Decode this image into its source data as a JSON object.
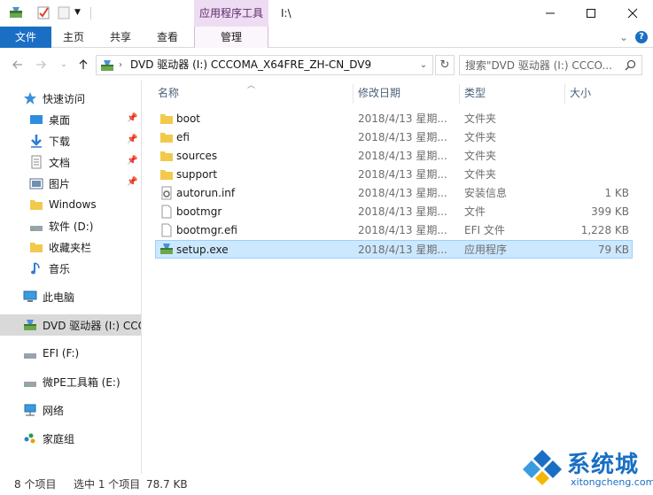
{
  "titlebar": {
    "context_tab": "应用程序工具",
    "path": "I:\\",
    "quick_access_icons": [
      "drive-setup-icon",
      "properties-icon",
      "new-folder-icon",
      "customize-dropdown-icon"
    ]
  },
  "ribbon": {
    "tabs": [
      {
        "label": "文件",
        "active": true
      },
      {
        "label": "主页"
      },
      {
        "label": "共享"
      },
      {
        "label": "查看"
      },
      {
        "label": "管理"
      }
    ]
  },
  "address_bar": {
    "path": "DVD 驱动器 (I:) CCCOMA_X64FRE_ZH-CN_DV9",
    "search_placeholder": "搜索\"DVD 驱动器 (I:) CCCO..."
  },
  "sidebar": {
    "items": [
      {
        "label": "快速访问",
        "icon": "star-icon"
      },
      {
        "label": "桌面",
        "icon": "desktop-icon",
        "pinned": true
      },
      {
        "label": "下载",
        "icon": "download-icon",
        "pinned": true
      },
      {
        "label": "文档",
        "icon": "document-icon",
        "pinned": true
      },
      {
        "label": "图片",
        "icon": "picture-icon",
        "pinned": true
      },
      {
        "label": "Windows",
        "icon": "folder-icon"
      },
      {
        "label": "软件 (D:)",
        "icon": "drive-icon"
      },
      {
        "label": "收藏夹栏",
        "icon": "folder-icon"
      },
      {
        "label": "音乐",
        "icon": "music-icon"
      },
      {
        "label": "此电脑",
        "icon": "computer-icon"
      },
      {
        "label": "DVD 驱动器 (I:) CCC",
        "icon": "dvd-drive-icon",
        "selected": true
      },
      {
        "label": "EFI (F:)",
        "icon": "drive-icon"
      },
      {
        "label": "微PE工具箱 (E:)",
        "icon": "drive-icon"
      },
      {
        "label": "网络",
        "icon": "network-icon"
      },
      {
        "label": "家庭组",
        "icon": "homegroup-icon"
      }
    ]
  },
  "columns": [
    "名称",
    "修改日期",
    "类型",
    "大小"
  ],
  "files": [
    {
      "name": "boot",
      "date": "2018/4/13 星期...",
      "type": "文件夹",
      "size": "",
      "icon": "folder-icon"
    },
    {
      "name": "efi",
      "date": "2018/4/13 星期...",
      "type": "文件夹",
      "size": "",
      "icon": "folder-icon"
    },
    {
      "name": "sources",
      "date": "2018/4/13 星期...",
      "type": "文件夹",
      "size": "",
      "icon": "folder-icon"
    },
    {
      "name": "support",
      "date": "2018/4/13 星期...",
      "type": "文件夹",
      "size": "",
      "icon": "folder-icon"
    },
    {
      "name": "autorun.inf",
      "date": "2018/4/13 星期...",
      "type": "安装信息",
      "size": "1 KB",
      "icon": "settings-file-icon"
    },
    {
      "name": "bootmgr",
      "date": "2018/4/13 星期...",
      "type": "文件",
      "size": "399 KB",
      "icon": "file-icon"
    },
    {
      "name": "bootmgr.efi",
      "date": "2018/4/13 星期...",
      "type": "EFI 文件",
      "size": "1,228 KB",
      "icon": "file-icon"
    },
    {
      "name": "setup.exe",
      "date": "2018/4/13 星期...",
      "type": "应用程序",
      "size": "79 KB",
      "icon": "setup-app-icon",
      "selected": true
    }
  ],
  "status": {
    "item_count": "8 个项目",
    "selection": "选中 1 个项目",
    "selection_size": "78.7 KB"
  },
  "watermark": {
    "title": "系统城",
    "url": "xitongcheng.com"
  },
  "colors": {
    "accent": "#1a6fc4",
    "context_tab": "#eedcf2",
    "selected_row": "#cce8ff",
    "folder": "#f2c94c"
  }
}
